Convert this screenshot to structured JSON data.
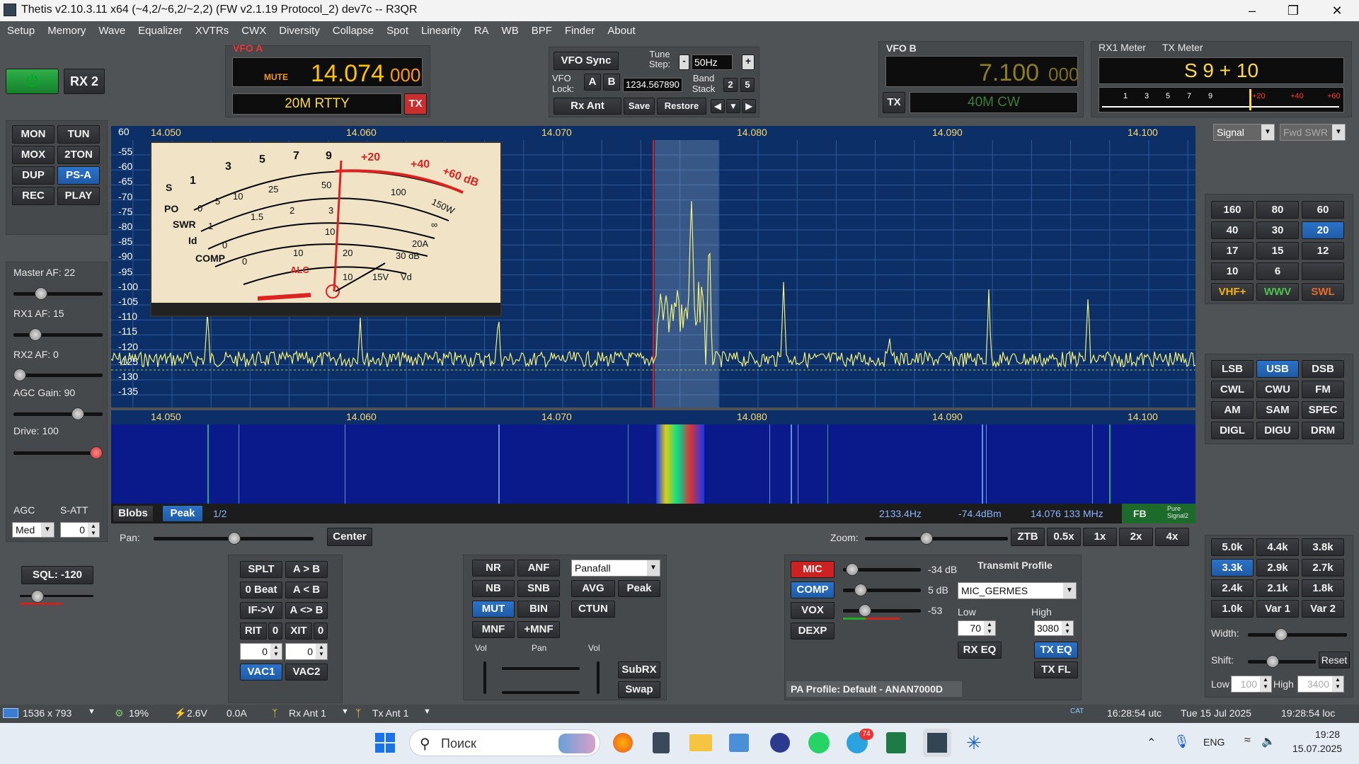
{
  "window": {
    "title": "Thetis v2.10.3.11 x64 (~4,2/~6,2/~2,2) (FW v2.1.19 Protocol_2) dev7c   --   R3QR"
  },
  "menu": [
    "Setup",
    "Memory",
    "Wave",
    "Equalizer",
    "XVTRs",
    "CWX",
    "Diversity",
    "Collapse",
    "Spot",
    "Linearity",
    "RA",
    "WB",
    "BPF",
    "Finder",
    "About"
  ],
  "top": {
    "rx2": "RX 2"
  },
  "vfoa": {
    "label": "VFO A",
    "mute": "MUTE",
    "freq_main": "14.074",
    "freq_sub": "000",
    "mode": "20M RTTY",
    "tx": "TX"
  },
  "vfo_mid": {
    "vfo_sync": "VFO Sync",
    "tune_step_label": "Tune Step:",
    "tune_minus": "-",
    "tune_step": "50Hz",
    "tune_plus": "+",
    "vfo_lock": "VFO Lock:",
    "a": "A",
    "b": "B",
    "lock_value": "1234.567890",
    "band_stack": "Band Stack",
    "bs1": "2",
    "bs2": "5",
    "rx_ant": "Rx Ant",
    "save": "Save",
    "restore": "Restore"
  },
  "vfob": {
    "label": "VFO B",
    "freq_main": "7.100",
    "freq_sub": "000",
    "tx": "TX",
    "mode": "40M CW"
  },
  "meters": {
    "rx1": "RX1 Meter",
    "tx": "TX Meter",
    "reading": "S 9 + 10",
    "scale": [
      "1",
      "3",
      "5",
      "7",
      "9",
      "+20",
      "+40",
      "+60"
    ],
    "sel1": "Signal",
    "sel2": "Fwd SWR"
  },
  "left_buttons": [
    "MON",
    "TUN",
    "MOX",
    "2TON",
    "DUP",
    "PS-A",
    "REC",
    "PLAY"
  ],
  "sliders": [
    {
      "label": "Master AF:  22",
      "level": 0.28
    },
    {
      "label": "RX1 AF:  15",
      "level": 0.2
    },
    {
      "label": "RX2 AF:  0",
      "level": 0.0
    },
    {
      "label": "AGC Gain:  90",
      "level": 0.76
    },
    {
      "label": "Drive:  100",
      "level": 1.0
    }
  ],
  "agc": {
    "agc_label": "AGC",
    "satt_label": "S-ATT",
    "agc_value": "Med",
    "satt_value": "0",
    "sql": "SQL: -120"
  },
  "spectrum": {
    "freq_labels": [
      "14.050",
      "14.060",
      "14.070",
      "14.080",
      "14.090",
      "14.100"
    ],
    "db_labels": [
      "60",
      "-55",
      "-60",
      "-65",
      "-70",
      "-75",
      "-80",
      "-85",
      "-90",
      "-95",
      "-100",
      "-105",
      "-110",
      "-115",
      "-120",
      "-125",
      "-130",
      "-135"
    ],
    "analog_meter": {
      "scales": [
        "S",
        "PO",
        "SWR",
        "Id",
        "COMP"
      ],
      "s_ticks": [
        "1",
        "3",
        "5",
        "7",
        "9",
        "+20",
        "+40",
        "+60 dB"
      ],
      "po_ticks": [
        "0",
        "5",
        "10",
        "25",
        "50",
        "100",
        "150W"
      ],
      "swr_ticks": [
        "1",
        "1.5",
        "2",
        "3",
        "∞"
      ],
      "id_ticks": [
        "0",
        "10",
        "20A"
      ],
      "comp_ticks": [
        "0",
        "10",
        "20",
        "30 dB"
      ],
      "alc": "ALC",
      "vd": [
        "10",
        "15V",
        "Vd"
      ]
    }
  },
  "pan": {
    "blobs": "Blobs",
    "peak": "Peak",
    "page": "1/2",
    "hz": "2133.4Hz",
    "dbm": "-74.4dBm",
    "mhz": "14.076 133 MHz",
    "fb": "FB",
    "pure": "Pure Signal2",
    "pan_label": "Pan:",
    "center": "Center",
    "zoom_label": "Zoom:",
    "zoom_btns": [
      "ZTB",
      "0.5x",
      "1x",
      "2x",
      "4x"
    ]
  },
  "bands": [
    "160",
    "80",
    "60",
    "40",
    "30",
    "20",
    "17",
    "15",
    "12",
    "10",
    "6",
    "",
    "VHF+",
    "WWV",
    "SWL"
  ],
  "modes": [
    "LSB",
    "USB",
    "DSB",
    "CWL",
    "CWU",
    "FM",
    "AM",
    "SAM",
    "SPEC",
    "DIGL",
    "DIGU",
    "DRM"
  ],
  "filters": [
    "5.0k",
    "4.4k",
    "3.8k",
    "3.3k",
    "2.9k",
    "2.7k",
    "2.4k",
    "2.1k",
    "1.8k",
    "1.0k",
    "Var 1",
    "Var 2"
  ],
  "filter_ctrl": {
    "width": "Width:",
    "shift": "Shift:",
    "reset": "Reset",
    "low": "Low",
    "low_val": "100",
    "high": "High",
    "high_val": "3400"
  },
  "split": {
    "splt": "SPLT",
    "atob": "A > B",
    "zbeat": "0 Beat",
    "btoa": "A < B",
    "ifv": "IF->V",
    "swap": "A <> B",
    "rit": "RIT",
    "rit_v": "0",
    "xit": "XIT",
    "xit_v": "0",
    "sp1": "0",
    "sp2": "0",
    "vac1": "VAC1",
    "vac2": "VAC2"
  },
  "dsp": {
    "nr": "NR",
    "anf": "ANF",
    "nb": "NB",
    "snb": "SNB",
    "mut": "MUT",
    "bin": "BIN",
    "mnf": "MNF",
    "pmnf": "+MNF",
    "display": "Panafall",
    "avg": "AVG",
    "peak": "Peak",
    "ctun": "CTUN",
    "vol": "Vol",
    "pan": "Pan",
    "vol2": "Vol",
    "subrx": "SubRX",
    "swapb": "Swap"
  },
  "tx": {
    "mic": "MIC",
    "mic_val": "-34 dB",
    "comp": "COMP",
    "comp_val": "5 dB",
    "vox": "VOX",
    "vox_val": "-53",
    "dexp": "DEXP",
    "profile_label": "Transmit Profile",
    "profile": "MIC_GERMES",
    "low": "Low",
    "low_val": "70",
    "high": "High",
    "high_val": "3080",
    "rxeq": "RX EQ",
    "txeq": "TX EQ",
    "txfl": "TX FL",
    "pa": "PA Profile: Default - ANAN7000D"
  },
  "status": {
    "res": "1536 x 793",
    "cpu": "19%",
    "volt": "2.6V",
    "amp": "0.0A",
    "rxant": "Rx Ant 1",
    "txant": "Tx Ant 1",
    "cat": "CAT",
    "utc": "16:28:54 utc",
    "date": "Tue 15 Jul 2025",
    "loc": "19:28:54 loc"
  },
  "taskbar": {
    "search": "Поиск",
    "lang": "ENG",
    "time": "19:28",
    "date": "15.07.2025",
    "badge": "74"
  }
}
